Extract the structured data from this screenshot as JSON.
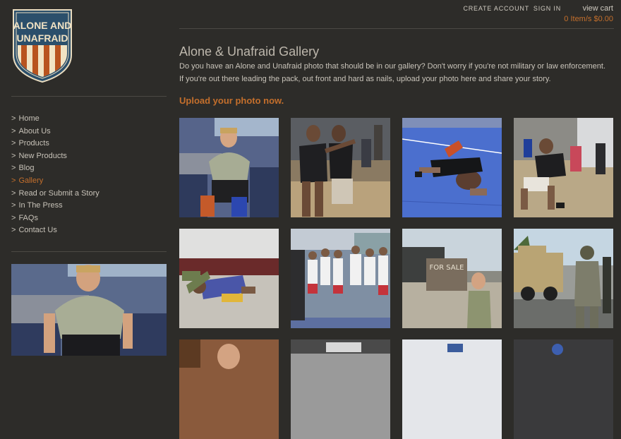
{
  "logo": {
    "line1": "ALONE AND",
    "line2": "UNAFRAID"
  },
  "header": {
    "create_account": "CREATE ACCOUNT",
    "sign_in": "SIGN IN",
    "view_cart": "view cart",
    "cart_summary": "0 Item/s $0.00"
  },
  "nav": {
    "items": [
      {
        "label": "Home"
      },
      {
        "label": "About Us"
      },
      {
        "label": "Products"
      },
      {
        "label": "New Products"
      },
      {
        "label": "Blog"
      },
      {
        "label": "Gallery",
        "active": true
      },
      {
        "label": "Read or Submit a Story"
      },
      {
        "label": "In The Press"
      },
      {
        "label": "FAQs"
      },
      {
        "label": "Contact Us"
      }
    ]
  },
  "main": {
    "title": "Alone & Unafraid Gallery",
    "intro_line1": "Do you have an Alone and Unafraid photo that should be in our gallery? Don't worry if you're not military or law enforcement.",
    "intro_line2": "If you're out there leading the pack, out front and hard as nails, upload your photo here and share your story.",
    "upload_link": "Upload your photo now."
  },
  "gallery": {
    "sign_text": "FOR SALE"
  },
  "colors": {
    "background": "#2d2c29",
    "accent": "#c46f2c",
    "text": "#cfcac0",
    "rule": "#4b4944",
    "logo_blue": "#2b4f6b",
    "logo_cream": "#f1e3c4"
  }
}
